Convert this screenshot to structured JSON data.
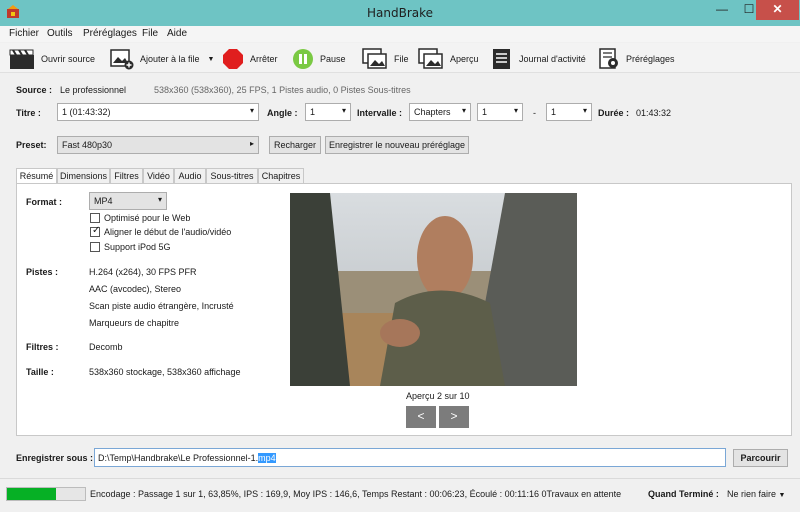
{
  "window": {
    "title": "HandBrake",
    "min": "—",
    "max": "☐",
    "close": "✕"
  },
  "menu": [
    "Fichier",
    "Outils",
    "Préréglages",
    "File",
    "Aide"
  ],
  "toolbar": {
    "open_source": "Ouvrir source",
    "add_to_queue": "Ajouter à la file",
    "stop": "Arrêter",
    "pause": "Pause",
    "queue": "File",
    "preview": "Aperçu",
    "activity_log": "Journal d'activité",
    "presets": "Préréglages"
  },
  "source": {
    "label": "Source :",
    "name": "Le professionnel",
    "info": "538x360 (538x360), 25 FPS, 1 Pistes audio, 0 Pistes Sous-titres"
  },
  "title_row": {
    "titre_label": "Titre :",
    "titre_value": "1 (01:43:32)",
    "angle_label": "Angle :",
    "angle_value": "1",
    "intervalle_label": "Intervalle :",
    "intervalle_mode": "Chapters",
    "from": "1",
    "dash": "-",
    "to": "1",
    "duree_label": "Durée :",
    "duree_value": "01:43:32"
  },
  "preset": {
    "label": "Preset:",
    "value": "Fast 480p30",
    "reload": "Recharger",
    "save_new": "Enregistrer le nouveau préréglage"
  },
  "tabs": [
    "Résumé",
    "Dimensions",
    "Filtres",
    "Vidéo",
    "Audio",
    "Sous-titres",
    "Chapitres"
  ],
  "summary": {
    "format_label": "Format :",
    "format_value": "MP4",
    "web_optimized": "Optimisé pour le Web",
    "align_av": "Aligner le début de l'audio/vidéo",
    "ipod": "Support iPod 5G",
    "web_optimized_checked": false,
    "align_av_checked": true,
    "ipod_checked": false,
    "pistes_label": "Pistes :",
    "pistes": [
      "H.264 (x264), 30 FPS PFR",
      "AAC (avcodec), Stereo",
      "Scan piste audio étrangère, Incrusté",
      "Marqueurs de chapitre"
    ],
    "filtres_label": "Filtres :",
    "filtres_value": "Decomb",
    "taille_label": "Taille :",
    "taille_value": "538x360 stockage, 538x360 affichage"
  },
  "preview_panel": {
    "caption": "Aperçu 2 sur 10",
    "prev": "<",
    "next": ">"
  },
  "save": {
    "label": "Enregistrer sous :",
    "path_prefix": "D:\\Temp\\Handbrake\\Le Professionnel-1.",
    "path_ext": "mp4",
    "browse": "Parcourir"
  },
  "status": {
    "progress": 0.63,
    "text": "Encodage : Passage 1 sur 1,  63,85%, IPS :  169,9, Moy IPS :  146,6,  Temps Restant : 00:06:23, Écoulé : 00:11:16 0Travaux en attente",
    "when_done_label": "Quand Terminé :",
    "when_done_value": "Ne rien faire"
  },
  "colors": {
    "titlebar": "#6ec4c4",
    "close": "#c7504a",
    "progress": "#06b025",
    "selection": "#3399ff"
  }
}
